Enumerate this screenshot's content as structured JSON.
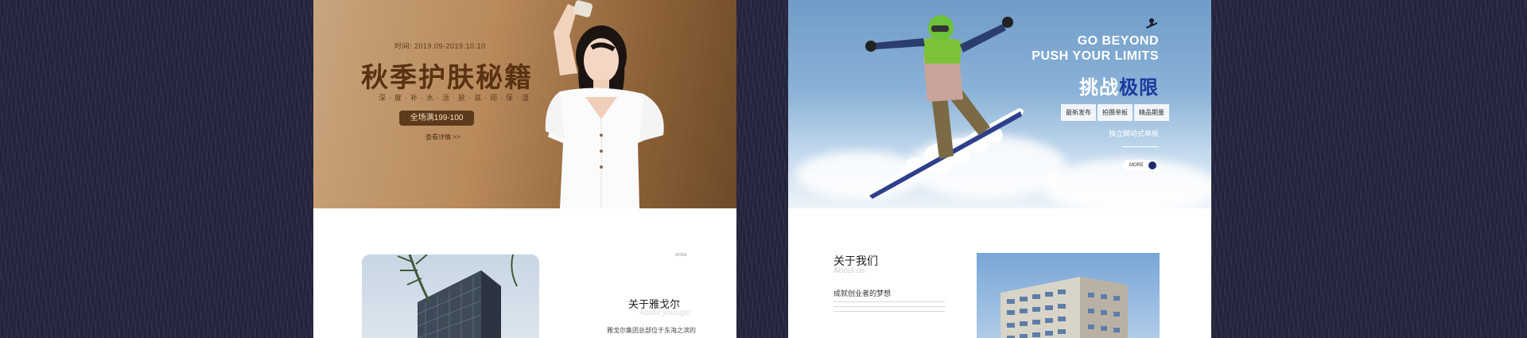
{
  "left_card": {
    "hero": {
      "date": "时间: 2019.09-2019.10.10",
      "title": "秋季护肤秘籍",
      "subtitle": "深·度·补·水·活·肤·滋·润·保·湿",
      "promo": "全场满199-100",
      "link": "查看详情 >>"
    },
    "about": {
      "more": "MORE",
      "title": "关于雅戈尔",
      "subtitle_en": "About younger",
      "desc": "雅戈尔集团总部位于东海之滨的"
    }
  },
  "right_card": {
    "hero": {
      "slogan_line1": "GO BEYOND",
      "slogan_line2": "PUSH YOUR LIMITS",
      "title_plain": "挑战",
      "title_accent": "极限",
      "tabs": [
        "最新发布",
        "拍摄单板",
        "精品期量"
      ],
      "tagline": "独立脚动式单板",
      "more": "MORE"
    },
    "about": {
      "title": "关于我们",
      "subtitle_en": "About us",
      "heading": "成就创业者的梦想"
    }
  },
  "colors": {
    "page_bg": "#262640",
    "left_hero_brown": "#b88a5c",
    "left_title": "#5a3212",
    "right_accent": "#1a3a9c"
  }
}
